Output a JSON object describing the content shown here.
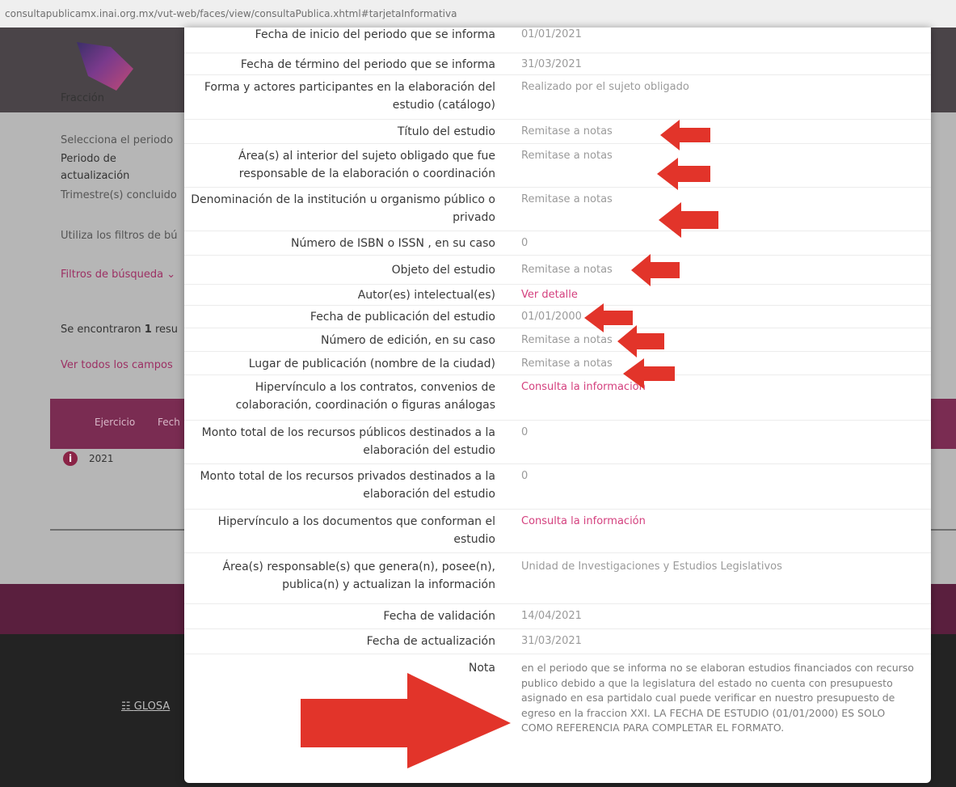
{
  "browser": {
    "url": "consultapublicamx.inai.org.mx/vut-web/faces/view/consultaPublica.xhtml#tarjetaInformativa"
  },
  "background": {
    "fraccion_label": "Fracción",
    "periodo_hint": "Selecciona el periodo",
    "periodo_label_line1": "Periodo de",
    "periodo_label_line2": "actualización",
    "trimestres": "Trimestre(s) concluido",
    "filtros_hint": "Utiliza los filtros de bú",
    "filtros_toggle": "Filtros de búsqueda ⌄",
    "resultados_prefix": "Se encontraron ",
    "resultados_count": "1",
    "resultados_suffix": " resu",
    "ver_todos": "Ver todos los campos",
    "table_headers": [
      "Ejercicio",
      "Fech"
    ],
    "table_row_year": "2021",
    "glosario": "GLOSA"
  },
  "detail": {
    "rows": [
      {
        "label": "Fecha de inicio del periodo que se informa",
        "value": "01/01/2021"
      },
      {
        "label": "Fecha de término del periodo que se informa",
        "value": "31/03/2021"
      },
      {
        "label": "Forma y actores participantes en la elaboración del estudio (catálogo)",
        "value": "Realizado por el sujeto obligado"
      },
      {
        "label": "Título del estudio",
        "value": "Remitase a notas"
      },
      {
        "label": "Área(s) al interior del sujeto obligado que fue responsable de la elaboración o coordinación",
        "value": "Remitase a notas"
      },
      {
        "label": "Denominación de la institución u organismo público o privado",
        "value": "Remitase a notas"
      },
      {
        "label": "Número de ISBN o ISSN , en su caso",
        "value": "0"
      },
      {
        "label": "Objeto del estudio",
        "value": "Remitase a notas"
      },
      {
        "label": "Autor(es) intelectual(es)",
        "value": "Ver detalle"
      },
      {
        "label": "Fecha de publicación del estudio",
        "value": "01/01/2000"
      },
      {
        "label": "Número de edición, en su caso",
        "value": "Remitase a notas"
      },
      {
        "label": "Lugar de publicación (nombre de la ciudad)",
        "value": "Remitase a notas"
      },
      {
        "label": "Hipervínculo a los contratos, convenios de colaboración, coordinación o figuras análogas",
        "value": "Consulta la información"
      },
      {
        "label": "Monto total de los recursos públicos destinados a la elaboración del estudio",
        "value": "0"
      },
      {
        "label": "Monto total de los recursos privados destinados a la elaboración del estudio",
        "value": "0"
      },
      {
        "label": "Hipervínculo a los documentos que conforman el estudio",
        "value": "Consulta la información"
      },
      {
        "label": "Área(s) responsable(s) que genera(n), posee(n), publica(n) y actualizan la información",
        "value": "Unidad de Investigaciones y Estudios Legislativos"
      },
      {
        "label": "Fecha de validación",
        "value": "14/04/2021"
      },
      {
        "label": "Fecha de actualización",
        "value": "31/03/2021"
      },
      {
        "label": "Nota",
        "value": "en el periodo que se informa no se elaboran estudios financiados con recurso publico debido a que la legislatura del estado no cuenta con presupuesto asignado en esa partidalo cual puede verificar en nuestro presupuesto de egreso en la fraccion XXI. LA FECHA DE ESTUDIO (01/01/2000) ES SOLO COMO REFERENCIA PARA COMPLETAR EL FORMATO."
      }
    ]
  },
  "colors": {
    "link": "#d4407e",
    "annotation_arrow": "#e2342a",
    "header_band": "#7a2c52"
  }
}
